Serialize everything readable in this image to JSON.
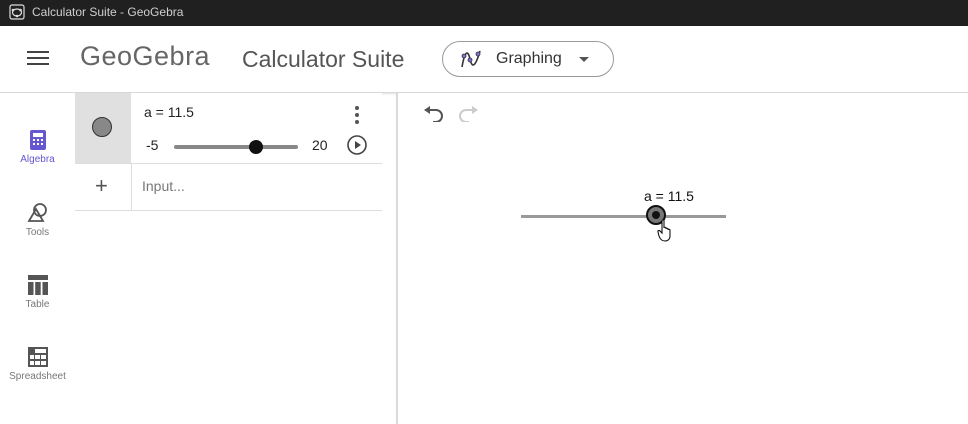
{
  "window": {
    "title": "Calculator Suite - GeoGebra"
  },
  "header": {
    "logo": "GeoGebra",
    "suite_name": "Calculator Suite",
    "app_picker": {
      "label": "Graphing",
      "icon": "graphing-icon"
    }
  },
  "nav": [
    {
      "label": "Algebra",
      "icon": "calculator-icon",
      "active": true
    },
    {
      "label": "Tools",
      "icon": "tools-shapes-icon",
      "active": false
    },
    {
      "label": "Table",
      "icon": "table-icon",
      "active": false
    },
    {
      "label": "Spreadsheet",
      "icon": "spreadsheet-icon",
      "active": false
    }
  ],
  "algebra": {
    "definition": "a = 11.5",
    "slider": {
      "min": "-5",
      "max": "20",
      "value": 11.5
    },
    "input_placeholder": "Input..."
  },
  "graphics": {
    "slider_label": "a = 11.5",
    "slider": {
      "min": -5,
      "max": 20,
      "value": 11.5
    }
  },
  "colors": {
    "accent": "#6557d2",
    "titlebar": "#202020"
  }
}
